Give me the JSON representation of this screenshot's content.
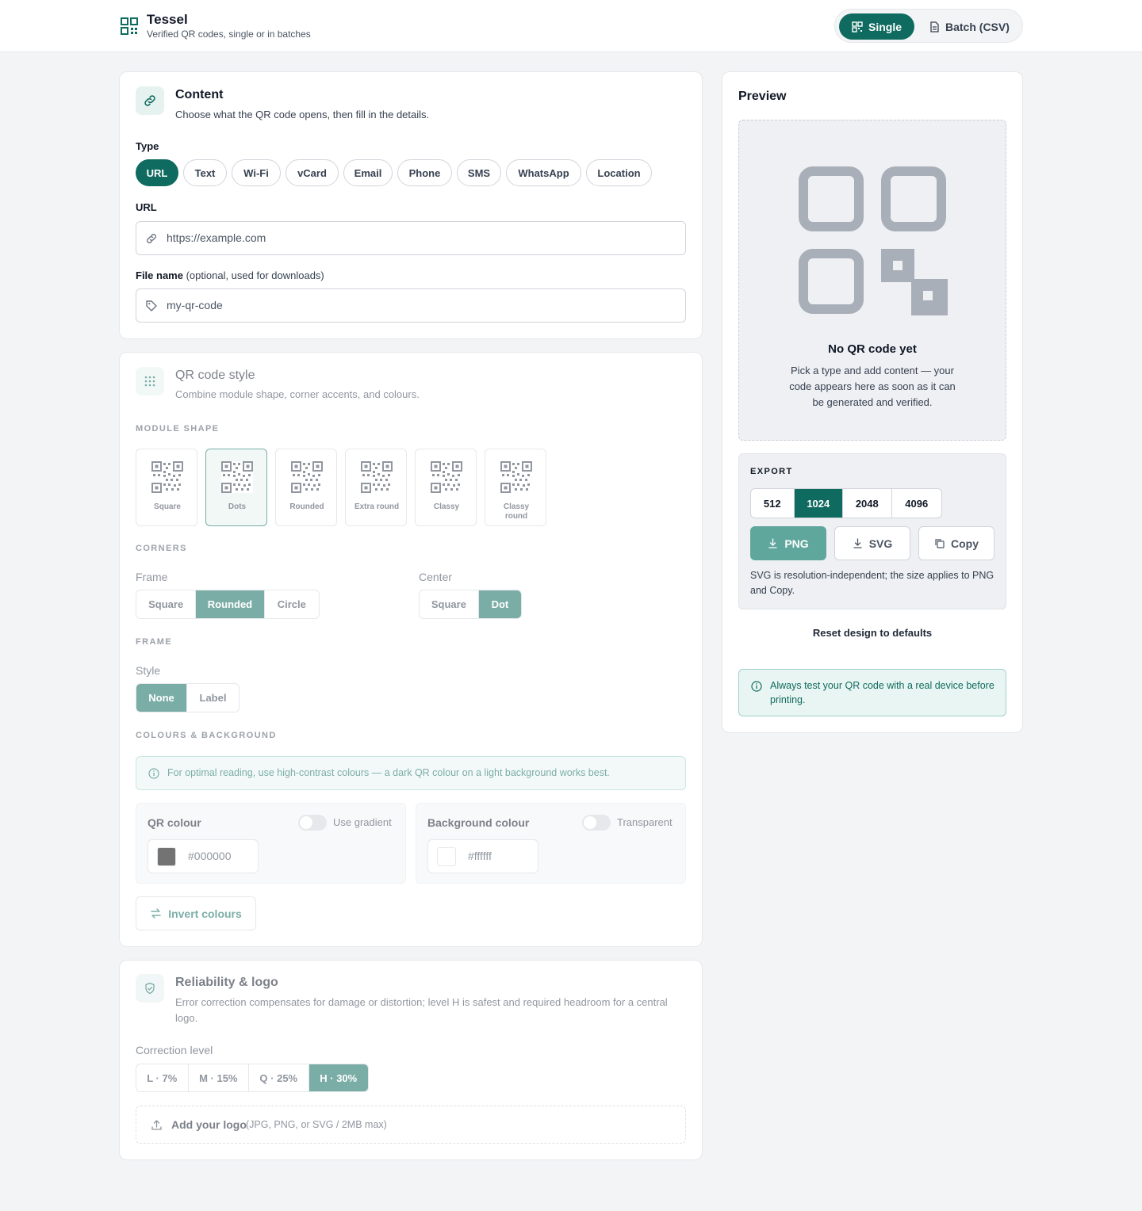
{
  "header": {
    "title": "Tessel",
    "subtitle": "Verified QR codes, single or in batches",
    "modes": {
      "single": "Single",
      "batch": "Batch (CSV)"
    }
  },
  "content": {
    "title": "Content",
    "subtitle": "Choose what the QR code opens, then fill in the details.",
    "type_label": "Type",
    "types": [
      "URL",
      "Text",
      "Wi-Fi",
      "vCard",
      "Email",
      "Phone",
      "SMS",
      "WhatsApp",
      "Location"
    ],
    "selected_type": "URL",
    "url_label": "URL",
    "url_placeholder": "https://example.com",
    "file_label": "File name",
    "file_label_hint": "(optional, used for downloads)",
    "file_placeholder": "my-qr-code"
  },
  "style": {
    "title": "QR code style",
    "subtitle": "Combine module shape, corner accents, and colours.",
    "module_caption": "MODULE SHAPE",
    "shapes": [
      "Square",
      "Dots",
      "Rounded",
      "Extra round",
      "Classy",
      "Classy round"
    ],
    "selected_shape": "Dots",
    "corners_caption": "CORNERS",
    "frame_label": "Frame",
    "frame_options": [
      "Square",
      "Rounded",
      "Circle"
    ],
    "frame_selected": "Rounded",
    "center_label": "Center",
    "center_options": [
      "Square",
      "Dot"
    ],
    "center_selected": "Dot",
    "frame_caption": "FRAME",
    "style_label": "Style",
    "style_options": [
      "None",
      "Label"
    ],
    "style_selected": "None",
    "colours_caption": "COLOURS & BACKGROUND",
    "contrast_note": "For optimal reading, use high-contrast colours — a dark QR colour on a light background works best.",
    "qr_colour_label": "QR colour",
    "gradient_label": "Use gradient",
    "qr_colour_value": "#000000",
    "bg_colour_label": "Background colour",
    "transparent_label": "Transparent",
    "bg_colour_value": "#ffffff",
    "invert_label": "Invert colours"
  },
  "reliability": {
    "title": "Reliability & logo",
    "subtitle": "Error correction compensates for damage or distortion; level H is safest and required headroom for a central logo.",
    "level_label": "Correction level",
    "levels": [
      "L · 7%",
      "M · 15%",
      "Q · 25%",
      "H · 30%"
    ],
    "selected_level": "H · 30%",
    "logo_label": "Add your logo",
    "logo_hint": "(JPG, PNG, or SVG / 2MB max)"
  },
  "preview": {
    "title": "Preview",
    "empty_title": "No QR code yet",
    "empty_text": "Pick a type and add content — your code appears here as soon as it can be generated and verified.",
    "export_caption": "EXPORT",
    "sizes": [
      "512",
      "1024",
      "2048",
      "4096"
    ],
    "selected_size": "1024",
    "png_label": "PNG",
    "svg_label": "SVG",
    "copy_label": "Copy",
    "export_note": "SVG is resolution-independent; the size applies to PNG and Copy.",
    "reset_label": "Reset design to defaults",
    "test_note": "Always test your QR code with a real device before printing."
  },
  "colors": {
    "accent": "#0f6b5f",
    "accent_light": "#e6f2ef",
    "placeholder_gray": "#a8afb8"
  }
}
